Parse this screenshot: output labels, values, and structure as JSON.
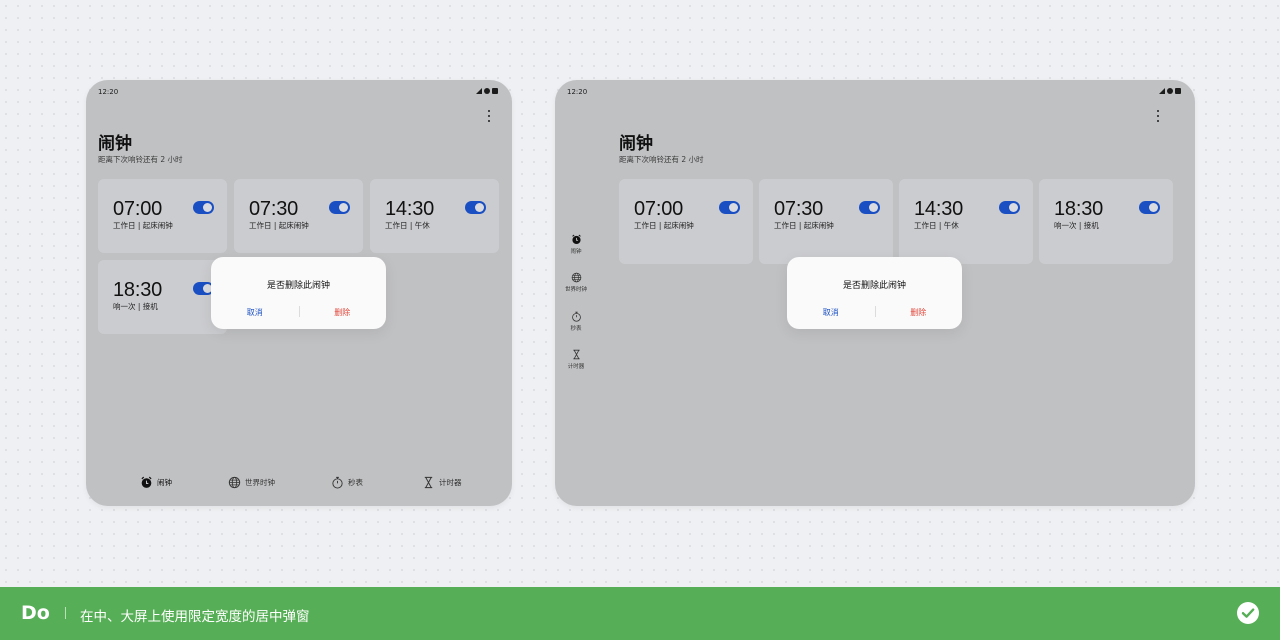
{
  "status_bar": {
    "time": "12:20"
  },
  "app": {
    "title": "闹钟",
    "subtitle": "距离下次响铃还有 2 小时"
  },
  "alarms": [
    {
      "time": "07:00",
      "label": "工作日 | 起床闹钟",
      "enabled": true
    },
    {
      "time": "07:30",
      "label": "工作日 | 起床闹钟",
      "enabled": true
    },
    {
      "time": "14:30",
      "label": "工作日 | 午休",
      "enabled": true
    },
    {
      "time": "18:30",
      "label": "响一次 | 接机",
      "enabled": true
    }
  ],
  "dialog": {
    "question": "是否删除此闹钟",
    "cancel": "取消",
    "delete": "删除"
  },
  "nav": [
    {
      "label": "闹钟",
      "icon": "alarm-clock-icon",
      "active": true
    },
    {
      "label": "世界时钟",
      "icon": "globe-icon",
      "active": false
    },
    {
      "label": "秒表",
      "icon": "stopwatch-icon",
      "active": false
    },
    {
      "label": "计时器",
      "icon": "hourglass-icon",
      "active": false
    }
  ],
  "banner": {
    "tag": "Do",
    "message": "在中、大屏上使用限定宽度的居中弹窗",
    "icon": "check-circle-icon"
  },
  "colors": {
    "accent": "#1a4fc3",
    "danger": "#e1463a",
    "banner": "#56ae56"
  }
}
